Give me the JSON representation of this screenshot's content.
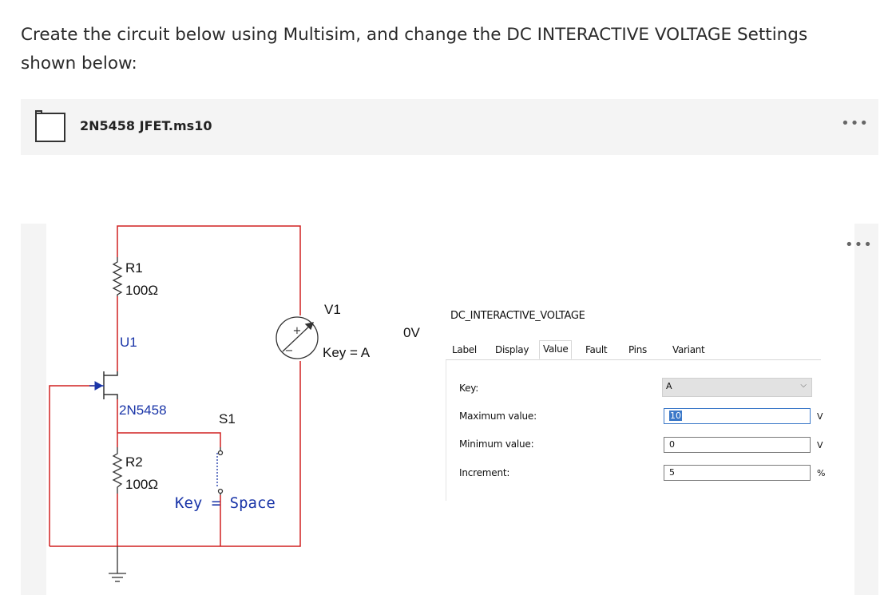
{
  "instructions": "Create the circuit below using Multisim, and change the DC INTERACTIVE VOLTAGE Settings shown below:",
  "file": {
    "name": "2N5458 JFET.ms10",
    "menu": "•••",
    "icon": "file-icon"
  },
  "canvas": {
    "menu": "•••"
  },
  "circuit": {
    "r1_name": "R1",
    "r1_value": "100Ω",
    "u1_name": "U1",
    "u1_part": "2N5458",
    "s1_name": "S1",
    "s1_key": "Key = Space",
    "r2_name": "R2",
    "r2_value": "100Ω",
    "v1_name": "V1",
    "v1_key": "Key = A",
    "v1_reading": "0V",
    "v1_plus": "+",
    "v1_minus": "−",
    "wire_color": "#d02020",
    "label_color": "#1a35a8"
  },
  "dialog": {
    "title": "DC_INTERACTIVE_VOLTAGE",
    "tabs": [
      "Label",
      "Display",
      "Value",
      "Fault",
      "Pins",
      "Variant"
    ],
    "active_tab": "Value",
    "key_label": "Key:",
    "key_value": "A",
    "max_label": "Maximum value:",
    "max_value": "10",
    "max_unit": "V",
    "min_label": "Minimum value:",
    "min_value": "0",
    "min_unit": "V",
    "inc_label": "Increment:",
    "inc_value": "5",
    "inc_unit": "%"
  }
}
